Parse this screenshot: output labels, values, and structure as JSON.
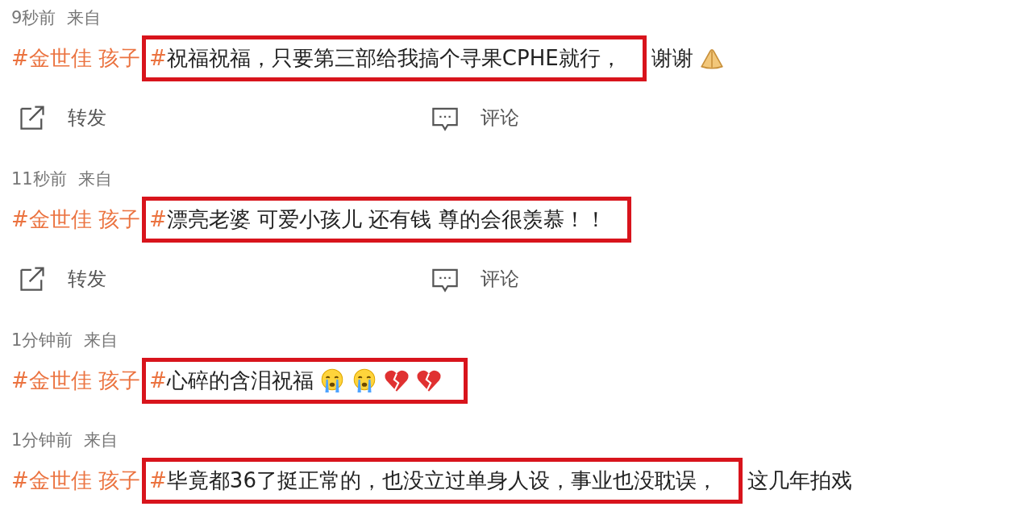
{
  "posts": [
    {
      "time": "9秒前",
      "source": "来自",
      "topic": "#金世佳 孩子",
      "highlight": {
        "topic_end": "#",
        "text": "祝福祝福，只要第三部给我搞个寻果CPHE就行，"
      },
      "after": {
        "text": "谢谢",
        "emojis": [
          {
            "kind": "pray"
          }
        ]
      },
      "actions": [
        {
          "kind": "repost",
          "label": "转发"
        },
        {
          "kind": "comment",
          "label": "评论"
        }
      ]
    },
    {
      "time": "11秒前",
      "source": "来自",
      "topic": "#金世佳 孩子",
      "highlight": {
        "topic_end": "#",
        "text": "漂亮老婆 可爱小孩儿 还有钱 尊的会很羡慕！！"
      },
      "actions": [
        {
          "kind": "repost",
          "label": "转发"
        },
        {
          "kind": "comment",
          "label": "评论"
        }
      ]
    },
    {
      "time": "1分钟前",
      "source": "来自",
      "topic": "#金世佳 孩子",
      "highlight": {
        "topic_end": "#",
        "text": "心碎的含泪祝福",
        "emojis": [
          {
            "kind": "crying"
          },
          {
            "kind": "crying"
          },
          {
            "kind": "broken-heart"
          },
          {
            "kind": "broken-heart"
          }
        ]
      }
    },
    {
      "time": "1分钟前",
      "source": "来自",
      "topic": "#金世佳 孩子",
      "highlight": {
        "topic_end": "#",
        "text": "毕竟都36了挺正常的，也没立过单身人设，事业也没耽误，"
      },
      "after": {
        "text": "这几年拍戏"
      }
    }
  ]
}
